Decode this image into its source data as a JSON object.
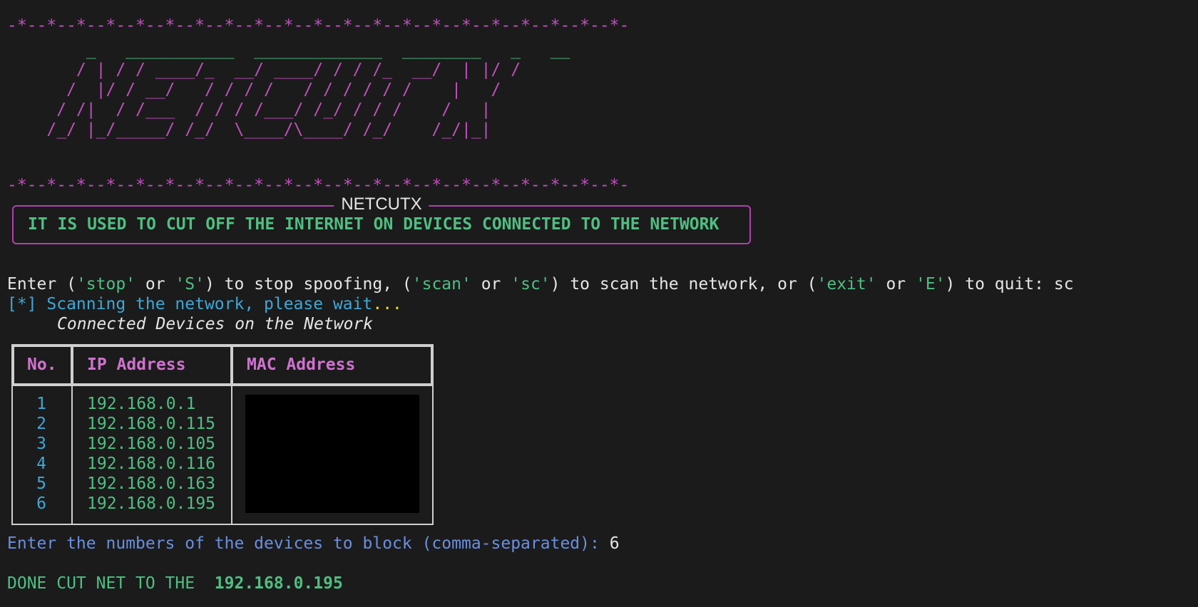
{
  "separator": "-*--*--*--*--*--*--*--*--*--*--*--*--*--*--*--*--*--*--*--*--*-",
  "banner_art": [
    "        _   ___________  _____________  ________   _   __",
    "       / | / / ____/_  __/ ____/ / / /_  __/  | |/ /",
    "      /  |/ / __/   / / / /   / / / / / /    |   / ",
    "     / /|  / /___  / / / /___/ /_/ / / /    /   |  ",
    "    /_/ |_/_____/ /_/  \\____/\\____/ /_/    /_/|_|  "
  ],
  "panel": {
    "title": "NETCUTX",
    "text": "IT IS USED TO CUT OFF THE INTERNET ON DEVICES CONNECTED TO THE NETWORK"
  },
  "prompt": {
    "enter": "Enter (",
    "stop_word": "'stop'",
    "or1": " or ",
    "s_word": "'S'",
    "after_s": ") to stop spoofing, (",
    "scan_word": "'scan'",
    "or2": " or ",
    "sc_word": "'sc'",
    "after_sc": ") to scan the network, or (",
    "exit_word": "'exit'",
    "or3": " or ",
    "e_word": "'E'",
    "after_e": ") to quit: ",
    "input": "sc"
  },
  "scanning": {
    "text": "[*] Scanning the network, please wait",
    "dots": "..."
  },
  "table": {
    "caption": "Connected Devices on the Network",
    "headers": [
      "No.",
      "IP Address",
      "MAC Address"
    ],
    "numbers": [
      "1",
      "2",
      "3",
      "4",
      "5",
      "6"
    ],
    "ips": [
      "192.168.0.1",
      "192.168.0.115",
      "192.168.0.105",
      "192.168.0.116",
      "192.168.0.163",
      "192.168.0.195"
    ]
  },
  "block_prompt": {
    "text": "Enter the numbers of the devices to block (comma-separated): ",
    "input": "6"
  },
  "result": {
    "label": "DONE CUT NET TO THE  ",
    "ip": "192.168.0.195"
  },
  "colors": {
    "background": "#1b1b1b",
    "magenta": "#c24fc0",
    "green": "#4fbf82",
    "cyan": "#3fa7d6",
    "blue": "#6a8fe0",
    "yellow": "#e5e510"
  }
}
